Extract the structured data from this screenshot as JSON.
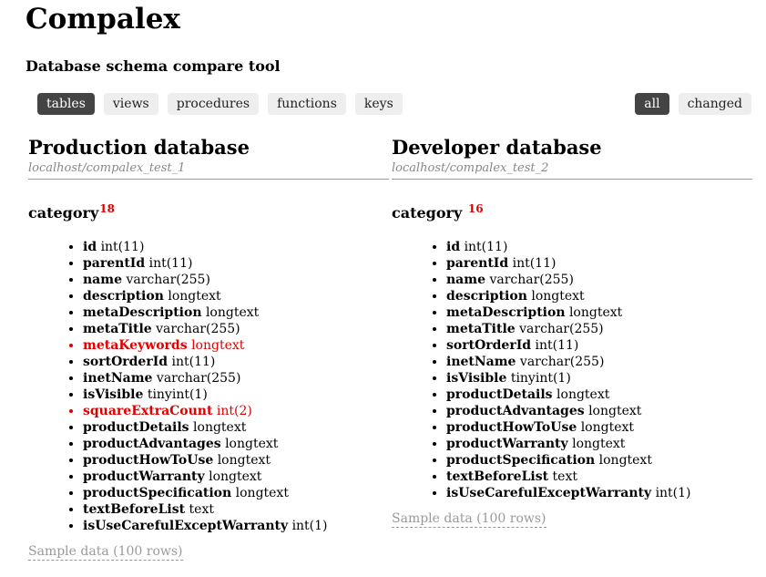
{
  "app": {
    "title": "Compalex",
    "subtitle": "Database schema compare tool"
  },
  "tabs": [
    {
      "label": "tables",
      "active": true
    },
    {
      "label": "views",
      "active": false
    },
    {
      "label": "procedures",
      "active": false
    },
    {
      "label": "functions",
      "active": false
    },
    {
      "label": "keys",
      "active": false
    }
  ],
  "filters": [
    {
      "label": "all",
      "active": true
    },
    {
      "label": "changed",
      "active": false
    }
  ],
  "databases": {
    "production": {
      "title": "Production database",
      "path": "localhost/compalex_test_1",
      "table_name": "category",
      "field_count": "18",
      "fields": [
        {
          "name": "id",
          "type": "int(11)",
          "diff": false
        },
        {
          "name": "parentId",
          "type": "int(11)",
          "diff": false
        },
        {
          "name": "name",
          "type": "varchar(255)",
          "diff": false
        },
        {
          "name": "description",
          "type": "longtext",
          "diff": false
        },
        {
          "name": "metaDescription",
          "type": "longtext",
          "diff": false
        },
        {
          "name": "metaTitle",
          "type": "varchar(255)",
          "diff": false
        },
        {
          "name": "metaKeywords",
          "type": "longtext",
          "diff": true
        },
        {
          "name": "sortOrderId",
          "type": "int(11)",
          "diff": false
        },
        {
          "name": "inetName",
          "type": "varchar(255)",
          "diff": false
        },
        {
          "name": "isVisible",
          "type": "tinyint(1)",
          "diff": false
        },
        {
          "name": "squareExtraCount",
          "type": "int(2)",
          "diff": true
        },
        {
          "name": "productDetails",
          "type": "longtext",
          "diff": false
        },
        {
          "name": "productAdvantages",
          "type": "longtext",
          "diff": false
        },
        {
          "name": "productHowToUse",
          "type": "longtext",
          "diff": false
        },
        {
          "name": "productWarranty",
          "type": "longtext",
          "diff": false
        },
        {
          "name": "productSpecification",
          "type": "longtext",
          "diff": false
        },
        {
          "name": "textBeforeList",
          "type": "text",
          "diff": false
        },
        {
          "name": "isUseCarefulExceptWarranty",
          "type": "int(1)",
          "diff": false
        }
      ],
      "sample_label": "Sample data (100 rows)"
    },
    "developer": {
      "title": "Developer database",
      "path": "localhost/compalex_test_2",
      "table_name": "category",
      "field_count": "16",
      "fields": [
        {
          "name": "id",
          "type": "int(11)",
          "diff": false
        },
        {
          "name": "parentId",
          "type": "int(11)",
          "diff": false
        },
        {
          "name": "name",
          "type": "varchar(255)",
          "diff": false
        },
        {
          "name": "description",
          "type": "longtext",
          "diff": false
        },
        {
          "name": "metaDescription",
          "type": "longtext",
          "diff": false
        },
        {
          "name": "metaTitle",
          "type": "varchar(255)",
          "diff": false
        },
        {
          "name": "sortOrderId",
          "type": "int(11)",
          "diff": false
        },
        {
          "name": "inetName",
          "type": "varchar(255)",
          "diff": false
        },
        {
          "name": "isVisible",
          "type": "tinyint(1)",
          "diff": false
        },
        {
          "name": "productDetails",
          "type": "longtext",
          "diff": false
        },
        {
          "name": "productAdvantages",
          "type": "longtext",
          "diff": false
        },
        {
          "name": "productHowToUse",
          "type": "longtext",
          "diff": false
        },
        {
          "name": "productWarranty",
          "type": "longtext",
          "diff": false
        },
        {
          "name": "productSpecification",
          "type": "longtext",
          "diff": false
        },
        {
          "name": "textBeforeList",
          "type": "text",
          "diff": false
        },
        {
          "name": "isUseCarefulExceptWarranty",
          "type": "int(1)",
          "diff": false
        }
      ],
      "sample_label": "Sample data (100 rows)"
    }
  },
  "colors": {
    "diff": "#e00000",
    "active_pill": "#444444",
    "pill": "#eeeeee"
  }
}
